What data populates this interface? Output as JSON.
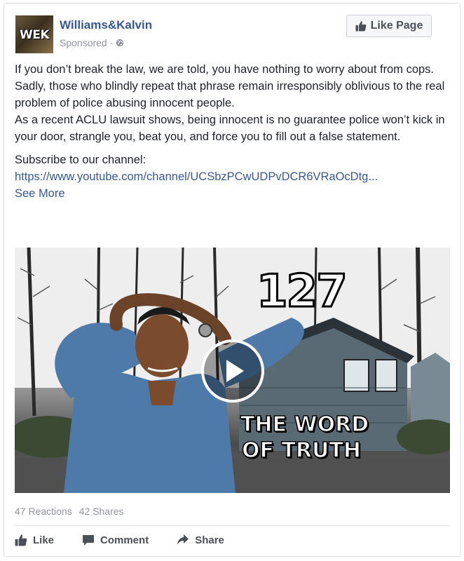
{
  "post": {
    "page_name": "Williams&Kalvin",
    "avatar_text": "WEK",
    "sponsored_label": "Sponsored",
    "sponsored_separator": "·",
    "like_page_label": "Like Page",
    "text_lines": {
      "p1": "If you don’t break the law, we are told, you have nothing to worry about from cops.",
      "p2": "Sadly, those who blindly repeat that phrase remain irresponsibly oblivious to the real problem of police abusing innocent people.",
      "p3": "As a recent ACLU lawsuit shows, being innocent is no guarantee police won’t kick in your door, strangle you, beat you, and force you to fill out a false statement."
    },
    "subscribe_label": "Subscribe to our channel:",
    "link_text": "https://www.youtube.com/channel/UCSbzPCwUDPvDCR6VRaOcDtg...",
    "see_more_label": "See More"
  },
  "video": {
    "episode_number": "127",
    "title_line_1": "THE WORD",
    "title_line_2": "OF TRUTH"
  },
  "stats": {
    "reactions": "47 Reactions",
    "shares": "42 Shares"
  },
  "actions": {
    "like": "Like",
    "comment": "Comment",
    "share": "Share"
  },
  "colors": {
    "link": "#365899",
    "meta": "#90949c",
    "action_text": "#4b4f56"
  }
}
